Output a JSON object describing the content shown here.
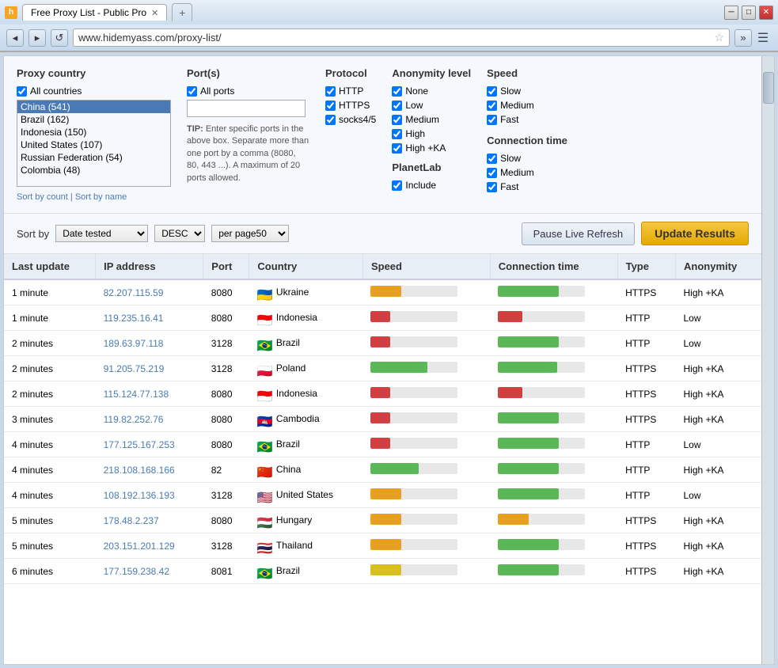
{
  "browser": {
    "title": "Free Proxy List - Public Pro",
    "tab_label": "Free Proxy List - Public Pro",
    "url": "www.hidemyass.com/proxy-list/",
    "icon": "h"
  },
  "filters": {
    "proxy_country_label": "Proxy country",
    "all_countries_label": "All countries",
    "countries": [
      {
        "name": "China (541)",
        "selected": true
      },
      {
        "name": "Brazil (162)",
        "selected": false
      },
      {
        "name": "Indonesia (150)",
        "selected": false
      },
      {
        "name": "United States (107)",
        "selected": false
      },
      {
        "name": "Russian Federation (54)",
        "selected": false
      },
      {
        "name": "Colombia (48)",
        "selected": false
      }
    ],
    "sort_by_count": "Sort by count",
    "sort_by_name": "Sort by name",
    "ports_label": "Port(s)",
    "all_ports_label": "All ports",
    "port_placeholder": "",
    "tip_text": "TIP: Enter specific ports in the above box. Separate more than one port by a comma (8080, 80, 443 ...). A maximum of 20 ports allowed.",
    "protocol_label": "Protocol",
    "protocols": [
      {
        "label": "HTTP",
        "checked": true
      },
      {
        "label": "HTTPS",
        "checked": true
      },
      {
        "label": "socks4/5",
        "checked": true
      }
    ],
    "anonymity_label": "Anonymity level",
    "anonymity_options": [
      {
        "label": "None",
        "checked": true
      },
      {
        "label": "Low",
        "checked": true
      },
      {
        "label": "Medium",
        "checked": true
      },
      {
        "label": "High",
        "checked": true
      },
      {
        "label": "High +KA",
        "checked": true
      }
    ],
    "planetlab_label": "PlanetLab",
    "planetlab_include": "Include",
    "speed_label": "Speed",
    "speed_options": [
      {
        "label": "Slow",
        "checked": true
      },
      {
        "label": "Medium",
        "checked": true
      },
      {
        "label": "Fast",
        "checked": true
      }
    ],
    "conn_time_label": "Connection time",
    "conn_time_options": [
      {
        "label": "Slow",
        "checked": true
      },
      {
        "label": "Medium",
        "checked": true
      },
      {
        "label": "Fast",
        "checked": true
      }
    ]
  },
  "sort_bar": {
    "sort_by_label": "Sort by",
    "sort_field": "Date tested",
    "sort_order": "DESC",
    "per_page": "per page50",
    "pause_label": "Pause Live Refresh",
    "update_label": "Update Results"
  },
  "table": {
    "headers": [
      "Last update",
      "IP address",
      "Port",
      "Country",
      "Speed",
      "Connection time",
      "Type",
      "Anonymity"
    ],
    "rows": [
      {
        "last_update": "1 minute",
        "ip": "82.207.115.59",
        "port": "8080",
        "country": "Ukraine",
        "flag": "🇺🇦",
        "speed_pct": 35,
        "speed_color": "orange",
        "conn_pct": 70,
        "conn_color": "green",
        "type": "HTTPS",
        "anonymity": "High +KA"
      },
      {
        "last_update": "1 minute",
        "ip": "119.235.16.41",
        "port": "8080",
        "country": "Indonesia",
        "flag": "🇮🇩",
        "speed_pct": 22,
        "speed_color": "red",
        "conn_pct": 28,
        "conn_color": "red",
        "type": "HTTP",
        "anonymity": "Low"
      },
      {
        "last_update": "2 minutes",
        "ip": "189.63.97.118",
        "port": "3128",
        "country": "Brazil",
        "flag": "🇧🇷",
        "speed_pct": 22,
        "speed_color": "red",
        "conn_pct": 70,
        "conn_color": "green",
        "type": "HTTP",
        "anonymity": "Low"
      },
      {
        "last_update": "2 minutes",
        "ip": "91.205.75.219",
        "port": "3128",
        "country": "Poland",
        "flag": "🇵🇱",
        "speed_pct": 65,
        "speed_color": "green",
        "conn_pct": 68,
        "conn_color": "green",
        "type": "HTTPS",
        "anonymity": "High +KA"
      },
      {
        "last_update": "2 minutes",
        "ip": "115.124.77.138",
        "port": "8080",
        "country": "Indonesia",
        "flag": "🇮🇩",
        "speed_pct": 22,
        "speed_color": "red",
        "conn_pct": 28,
        "conn_color": "red",
        "type": "HTTPS",
        "anonymity": "High +KA"
      },
      {
        "last_update": "3 minutes",
        "ip": "119.82.252.76",
        "port": "8080",
        "country": "Cambodia",
        "flag": "🇰🇭",
        "speed_pct": 22,
        "speed_color": "red",
        "conn_pct": 70,
        "conn_color": "green",
        "type": "HTTPS",
        "anonymity": "High +KA"
      },
      {
        "last_update": "4 minutes",
        "ip": "177.125.167.253",
        "port": "8080",
        "country": "Brazil",
        "flag": "🇧🇷",
        "speed_pct": 22,
        "speed_color": "red",
        "conn_pct": 70,
        "conn_color": "green",
        "type": "HTTP",
        "anonymity": "Low"
      },
      {
        "last_update": "4 minutes",
        "ip": "218.108.168.166",
        "port": "82",
        "country": "China",
        "flag": "🇨🇳",
        "speed_pct": 55,
        "speed_color": "green",
        "conn_pct": 70,
        "conn_color": "green",
        "type": "HTTP",
        "anonymity": "High +KA"
      },
      {
        "last_update": "4 minutes",
        "ip": "108.192.136.193",
        "port": "3128",
        "country": "United States",
        "flag": "🇺🇸",
        "speed_pct": 35,
        "speed_color": "orange",
        "conn_pct": 70,
        "conn_color": "green",
        "type": "HTTP",
        "anonymity": "Low"
      },
      {
        "last_update": "5 minutes",
        "ip": "178.48.2.237",
        "port": "8080",
        "country": "Hungary",
        "flag": "🇭🇺",
        "speed_pct": 35,
        "speed_color": "orange",
        "conn_pct": 35,
        "conn_color": "orange",
        "type": "HTTPS",
        "anonymity": "High +KA"
      },
      {
        "last_update": "5 minutes",
        "ip": "203.151.201.129",
        "port": "3128",
        "country": "Thailand",
        "flag": "🇹🇭",
        "speed_pct": 35,
        "speed_color": "orange",
        "conn_pct": 70,
        "conn_color": "green",
        "type": "HTTPS",
        "anonymity": "High +KA"
      },
      {
        "last_update": "6 minutes",
        "ip": "177.159.238.42",
        "port": "8081",
        "country": "Brazil",
        "flag": "🇧🇷",
        "speed_pct": 35,
        "speed_color": "yellow",
        "conn_pct": 70,
        "conn_color": "green",
        "type": "HTTPS",
        "anonymity": "High +KA"
      }
    ]
  }
}
